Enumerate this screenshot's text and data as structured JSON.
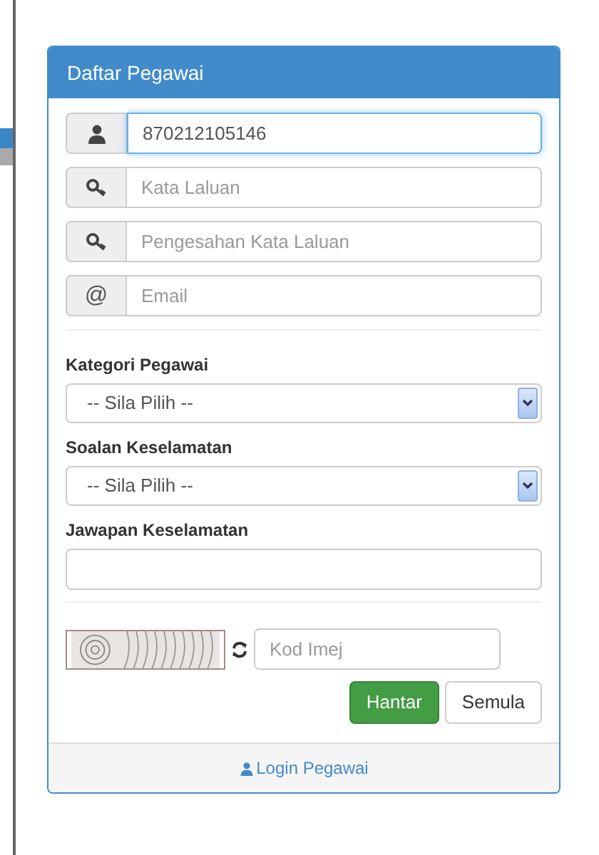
{
  "panel": {
    "title": "Daftar Pegawai"
  },
  "inputs": [
    {
      "kind": "user",
      "value": "870212105146",
      "focused": true
    },
    {
      "kind": "key",
      "placeholder": "Kata Laluan",
      "focused": false
    },
    {
      "kind": "key",
      "placeholder": "Pengesahan Kata Laluan",
      "focused": false
    },
    {
      "kind": "at",
      "text": "@",
      "placeholder": "Email",
      "focused": false
    }
  ],
  "fields": [
    {
      "kind": "select",
      "label": "Kategori Pegawai",
      "value": "-- Sila Pilih --"
    },
    {
      "kind": "select",
      "label": "Soalan Keselamatan",
      "value": "-- Sila Pilih --"
    },
    {
      "kind": "text",
      "label": "Jawapan Keselamatan"
    }
  ],
  "captcha": {
    "placeholder": "Kod Imej"
  },
  "buttons": [
    {
      "kind": "primary",
      "label": "Hantar"
    },
    {
      "kind": "default",
      "label": "Semula"
    }
  ],
  "footer": {
    "link": "Login Pegawai"
  }
}
